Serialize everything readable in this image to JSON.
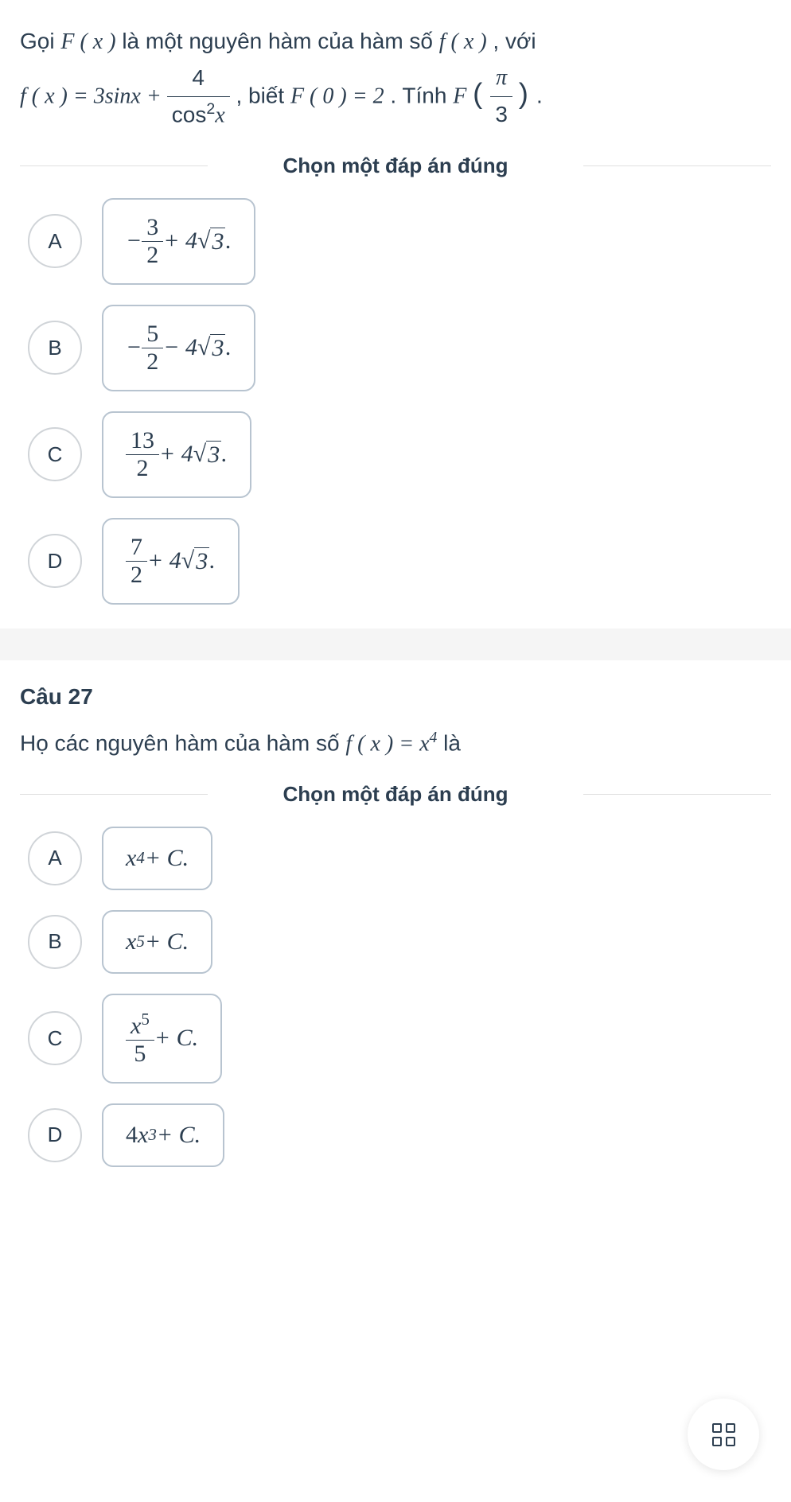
{
  "q1": {
    "text_part1": "Gọi ",
    "text_part2": " là một nguyên hàm của hàm số ",
    "text_part3": " , với",
    "text_part4": " , biết ",
    "text_part5": ". Tính ",
    "F_x": "F ( x )",
    "f_x": "f ( x )",
    "eq_lhs": "f ( x ) = 3sinx + ",
    "frac_num": "4",
    "frac_den_cos": "cos",
    "frac_den_exp": "2",
    "frac_den_x": "x",
    "F0": "F ( 0 ) = 2",
    "F_calc": "F",
    "pi": "π",
    "three": "3",
    "dot": " .",
    "instruction": "Chọn một đáp án đúng",
    "options": {
      "A": {
        "letter": "A",
        "prefix": "− ",
        "num": "3",
        "den": "2",
        "mid": " + 4",
        "root": "3",
        "suffix": "."
      },
      "B": {
        "letter": "B",
        "prefix": "− ",
        "num": "5",
        "den": "2",
        "mid": " − 4",
        "root": "3",
        "suffix": "."
      },
      "C": {
        "letter": "C",
        "prefix": "",
        "num": "13",
        "den": "2",
        "mid": " + 4",
        "root": "3",
        "suffix": "."
      },
      "D": {
        "letter": "D",
        "prefix": "",
        "num": "7",
        "den": "2",
        "mid": " + 4",
        "root": "3",
        "suffix": "."
      }
    }
  },
  "q2": {
    "title": "Câu 27",
    "text_part1": "Họ các nguyên hàm của hàm số ",
    "f_x": "f ( x ) = x",
    "exp4": "4",
    "text_part2": " là",
    "instruction": "Chọn một đáp án đúng",
    "options": {
      "A": {
        "letter": "A",
        "base": "x",
        "exp": "4",
        "rest": " + C."
      },
      "B": {
        "letter": "B",
        "base": "x",
        "exp": "5",
        "rest": " + C."
      },
      "C": {
        "letter": "C",
        "num_base": "x",
        "num_exp": "5",
        "den": "5",
        "rest": " + C."
      },
      "D": {
        "letter": "D",
        "coef": "4",
        "base": "x",
        "exp": "3",
        "rest": " + C."
      }
    }
  }
}
